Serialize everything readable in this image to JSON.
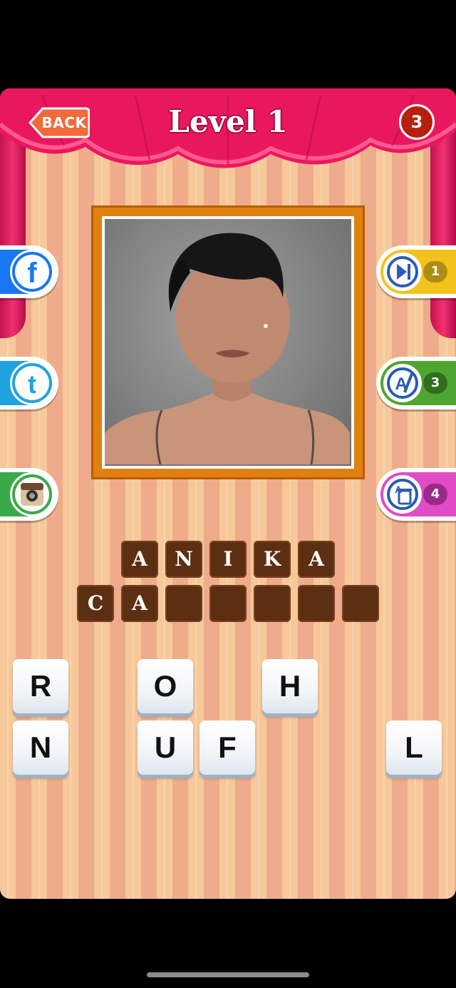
{
  "header": {
    "back_label": "BACK",
    "level_title": "Level 1",
    "coins": "3"
  },
  "social": [
    {
      "name": "facebook",
      "glyph": "f",
      "color": "#1877f2"
    },
    {
      "name": "tumblr",
      "glyph": "t",
      "color": "#1fa3e0"
    },
    {
      "name": "instagram",
      "glyph": "",
      "color": "#3aa948"
    }
  ],
  "hints": [
    {
      "name": "skip",
      "count": "1",
      "color": "#f2c31c"
    },
    {
      "name": "reveal-letter",
      "count": "3",
      "color": "#4ea52f"
    },
    {
      "name": "remove-letters",
      "count": "4",
      "color": "#e04bc6"
    }
  ],
  "answer": {
    "row1": [
      "A",
      "N",
      "I",
      "K",
      "A"
    ],
    "row2": [
      "C",
      "A",
      "",
      "",
      "",
      "",
      ""
    ]
  },
  "keys": [
    "R",
    "O",
    "H",
    "N",
    "U",
    "F",
    "L"
  ]
}
